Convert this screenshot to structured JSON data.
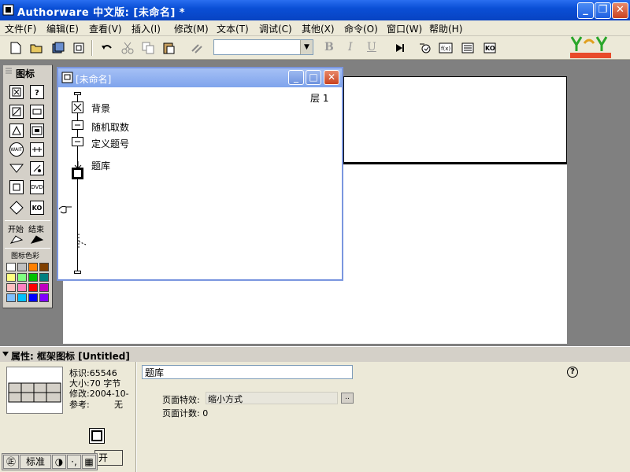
{
  "window": {
    "title": "Authorware 中文版: [未命名] *",
    "minimize": "_",
    "maximize": "❐",
    "close": "✕"
  },
  "menu": [
    "文件(F)",
    "编辑(E)",
    "查看(V)",
    "插入(I)",
    "修改(M)",
    "文本(T)",
    "调试(C)",
    "其他(X)",
    "命令(O)",
    "窗口(W)",
    "帮助(H)"
  ],
  "toolbar": {
    "font_value": "",
    "bold": "B",
    "italic": "I",
    "underline": "U"
  },
  "palette": {
    "title": "图标",
    "start_label": "开始",
    "end_label": "结束",
    "colors_label": "图标色彩",
    "swatches": [
      "#ffffff",
      "#c0c0c0",
      "#ff8000",
      "#804000",
      "#ffff80",
      "#80ff80",
      "#00c000",
      "#008080",
      "#ffc0c0",
      "#ff80c0",
      "#ff0000",
      "#c000c0",
      "#80c0ff",
      "#00c0ff",
      "#0000ff",
      "#8000ff"
    ]
  },
  "flow_window": {
    "title": "[未命名]",
    "layer": "层 1",
    "icons": [
      {
        "label": "背景"
      },
      {
        "label": "随机取数"
      },
      {
        "label": "定义题号"
      },
      {
        "label": "题库"
      }
    ]
  },
  "properties": {
    "header": "属性: 框架图标 [Untitled]",
    "id_line": "标识:65546",
    "size_line": "大小:70 字节",
    "modified_line": "修改:2004-10-",
    "ref_label": "参考:",
    "ref_value": "无",
    "name_value": "题库",
    "effect_label": "页面特效:",
    "effect_value": "缩小方式",
    "page_count": "页面计数: 0",
    "help": "?"
  },
  "ime": {
    "mode": "标准",
    "open_partial": "开"
  }
}
